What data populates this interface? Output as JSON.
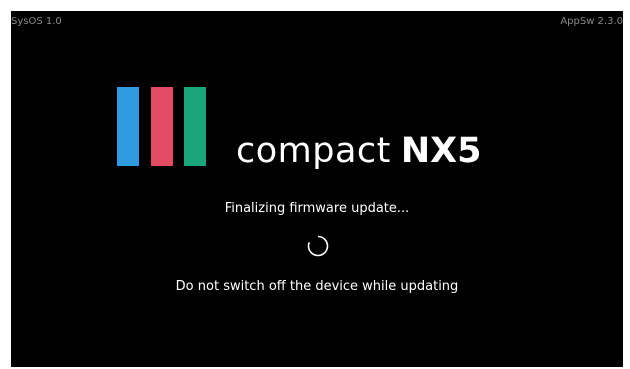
{
  "header": {
    "system_version": "SysOS 1.0",
    "app_version": "AppSw 2.3.0"
  },
  "logo": {
    "bar_colors": [
      "#2f9be0",
      "#e34a64",
      "#1aa57a"
    ],
    "product_prefix": "compact",
    "product_model": "NX5"
  },
  "update": {
    "status": "Finalizing firmware update...",
    "spinner_icon": "loading-spinner-icon",
    "warning": "Do not switch off the device while updating"
  },
  "colors": {
    "background": "#000000",
    "text": "#ffffff",
    "corner_text": "#8a8a8a"
  }
}
